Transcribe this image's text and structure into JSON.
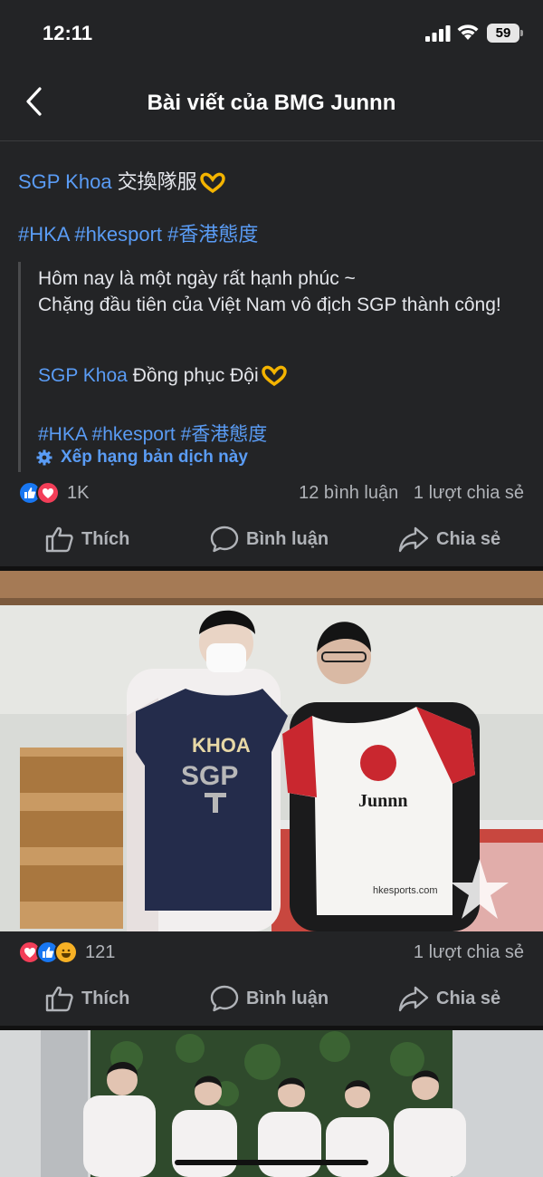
{
  "status_bar": {
    "time": "12:11",
    "battery": "59"
  },
  "header": {
    "title": "Bài viết của BMG Junnn"
  },
  "post": {
    "mention": "SGP Khoa",
    "text_cn": " 交換隊服",
    "hashtags": [
      "#HKA",
      "#hkesport",
      "#香港態度"
    ],
    "translation": {
      "line1": "Hôm nay là một ngày rất hạnh phúc ~",
      "line2": "Chặng đầu tiên của Việt Nam vô địch SGP thành công!",
      "mention": "SGP Khoa",
      "text": " Đồng phục Đội",
      "hashtags": [
        "#HKA",
        "#hkesport",
        "#香港態度"
      ]
    },
    "rate_label": "Xếp hạng bản dịch này",
    "reactions_count": "1K",
    "comments": "12 bình luận",
    "shares": "1 lượt chia sẻ"
  },
  "photo1": {
    "jersey_left_name": "KHOA",
    "jersey_left_team": "SGP",
    "jersey_right_name": "Junnn",
    "jersey_right_site": "hkesports.com",
    "reactions_count": "121",
    "shares": "1 lượt chia sẻ"
  },
  "actions": {
    "like": "Thích",
    "comment": "Bình luận",
    "share": "Chia sẻ"
  },
  "colors": {
    "background": "#232426",
    "link": "#5a9cf5",
    "like_blue": "#1877f2",
    "love_red": "#f33e58"
  }
}
